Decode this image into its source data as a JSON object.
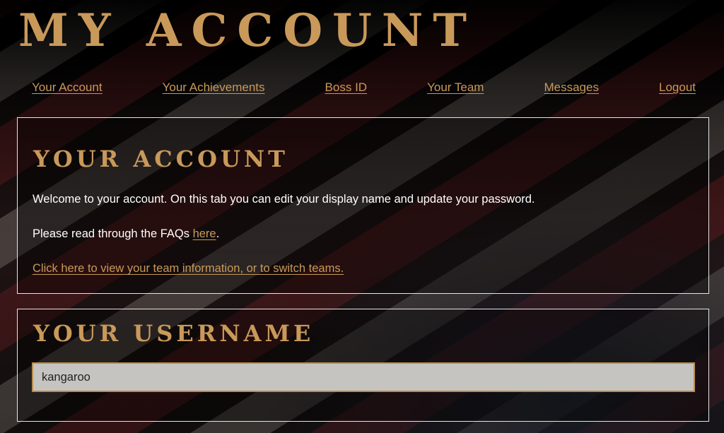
{
  "page": {
    "title": "MY ACCOUNT"
  },
  "nav": {
    "items": [
      {
        "label": "Your Account"
      },
      {
        "label": "Your Achievements"
      },
      {
        "label": "Boss ID"
      },
      {
        "label": "Your Team"
      },
      {
        "label": "Messages"
      },
      {
        "label": "Logout"
      }
    ]
  },
  "account_panel": {
    "title": "YOUR ACCOUNT",
    "welcome_text": "Welcome to your account. On this tab you can edit your display name and update your password.",
    "faq_text": "Please read through the FAQs ",
    "faq_link": "here",
    "faq_suffix": ".",
    "team_link": "Click here to view your team information, or to switch teams."
  },
  "username_panel": {
    "title": "YOUR USERNAME",
    "value": "kangaroo"
  },
  "colors": {
    "accent": "#c9995a",
    "background": "#000000",
    "panel_border": "#e6e6e6",
    "input_bg": "#c6c4c0"
  }
}
